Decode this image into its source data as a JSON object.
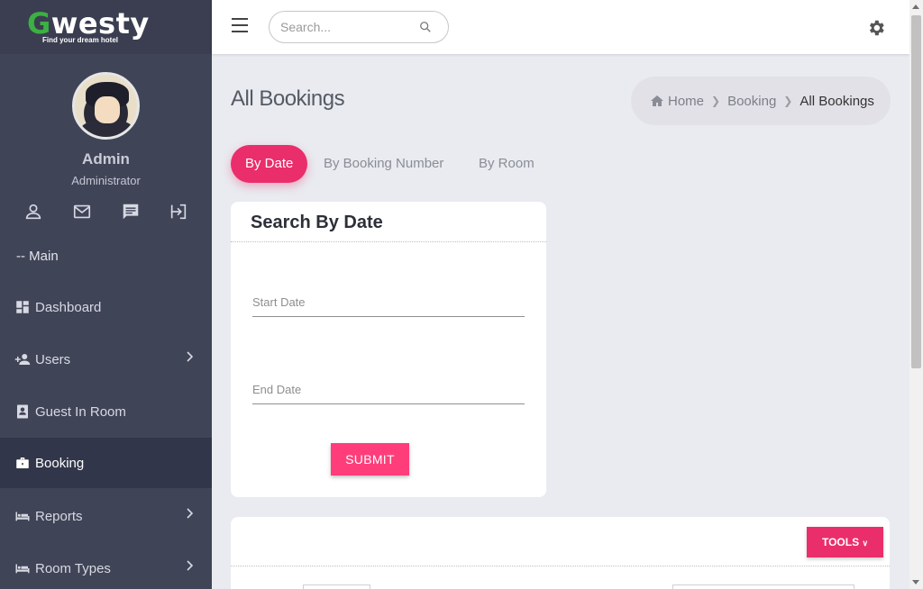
{
  "brand": {
    "logo_first": "G",
    "logo_rest": "westy",
    "tagline": "Find your dream hotel"
  },
  "user": {
    "name": "Admin",
    "role": "Administrator"
  },
  "user_icons": [
    "profile-icon",
    "mail-icon",
    "chat-icon",
    "logout-icon"
  ],
  "sidebar": {
    "section": "-- Main",
    "items": [
      {
        "label": "Dashboard",
        "icon": "dashboard-icon",
        "has_submenu": false
      },
      {
        "label": "Users",
        "icon": "add-user-icon",
        "has_submenu": true
      },
      {
        "label": "Guest In Room",
        "icon": "contact-icon",
        "has_submenu": false
      },
      {
        "label": "Booking",
        "icon": "briefcase-icon",
        "has_submenu": false,
        "active": true
      },
      {
        "label": "Reports",
        "icon": "bed-icon",
        "has_submenu": true
      },
      {
        "label": "Room Types",
        "icon": "bed-icon",
        "has_submenu": true
      }
    ]
  },
  "header": {
    "search_placeholder": "Search..."
  },
  "page": {
    "title": "All Bookings"
  },
  "breadcrumb": {
    "home": "Home",
    "parent": "Booking",
    "current": "All Bookings"
  },
  "tabs": [
    {
      "label": "By Date",
      "active": true
    },
    {
      "label": "By Booking Number",
      "active": false
    },
    {
      "label": "By Room",
      "active": false
    }
  ],
  "search_card": {
    "title": "Search By Date",
    "start_placeholder": "Start Date",
    "end_placeholder": "End Date",
    "submit_label": "SUBMIT"
  },
  "table_card": {
    "tools_label": "TOOLS"
  },
  "colors": {
    "sidebar": "#404457",
    "accent": "#ea2e6b",
    "logo_green": "#3cb043"
  }
}
